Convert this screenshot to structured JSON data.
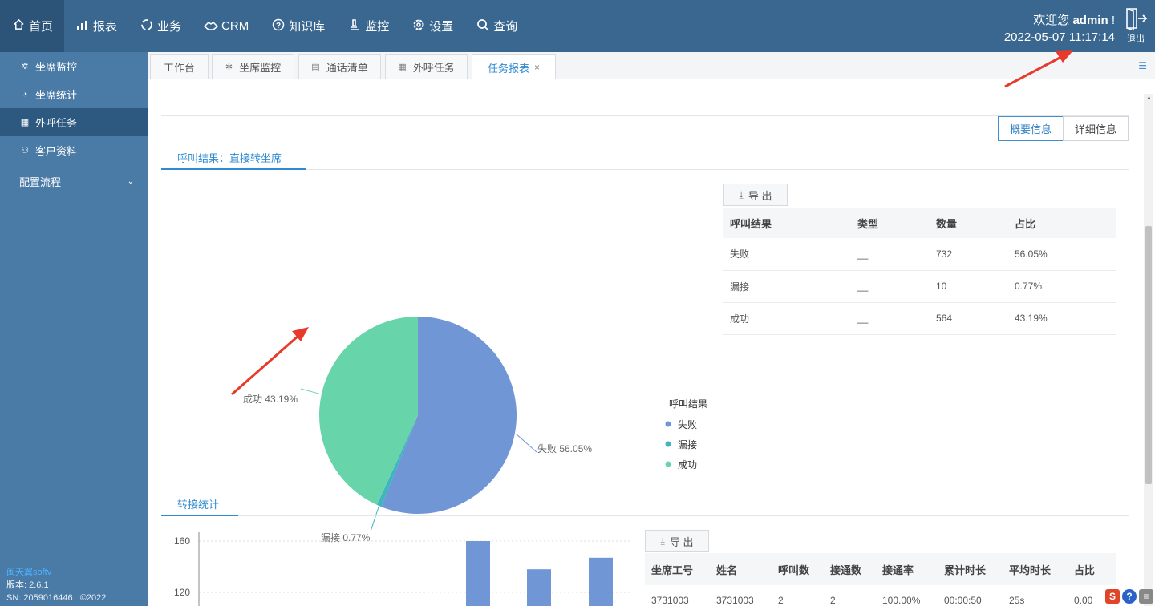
{
  "nav": {
    "items": [
      {
        "label": "首页",
        "icon": "home-icon"
      },
      {
        "label": "报表",
        "icon": "report-icon"
      },
      {
        "label": "业务",
        "icon": "business-icon"
      },
      {
        "label": "CRM",
        "icon": "crm-icon"
      },
      {
        "label": "知识库",
        "icon": "knowledge-icon"
      },
      {
        "label": "监控",
        "icon": "monitor-icon"
      },
      {
        "label": "设置",
        "icon": "gear-icon"
      },
      {
        "label": "查询",
        "icon": "search-icon"
      }
    ],
    "welcome_prefix": "欢迎您",
    "user": "admin",
    "welcome_suffix": "!",
    "datetime": "2022-05-07 11:17:14",
    "logout": "退出"
  },
  "sidebar": {
    "items": [
      {
        "label": "坐席监控",
        "icon": "agent-monitor-icon"
      },
      {
        "label": "坐席统计",
        "icon": "agent-stats-icon"
      },
      {
        "label": "外呼任务",
        "icon": "grid-icon"
      },
      {
        "label": "客户资料",
        "icon": "user-icon"
      }
    ],
    "group": "配置流程",
    "footer": {
      "brand": "闽天翼softv",
      "version": "版本: 2.6.1",
      "sn": "SN: 2059016446",
      "copyright": "©2022"
    }
  },
  "tabs": [
    {
      "label": "工作台"
    },
    {
      "label": "坐席监控"
    },
    {
      "label": "通话清单"
    },
    {
      "label": "外呼任务"
    },
    {
      "label": "任务报表"
    }
  ],
  "view_buttons": {
    "summary": "概要信息",
    "detail": "详细信息"
  },
  "section1": {
    "title": "呼叫结果：直接转坐席",
    "export": "导 出",
    "table": {
      "headers": [
        "呼叫结果",
        "类型",
        "数量",
        "占比"
      ],
      "rows": [
        [
          "失败",
          "__",
          "732",
          "56.05%"
        ],
        [
          "漏接",
          "__",
          "10",
          "0.77%"
        ],
        [
          "成功",
          "__",
          "564",
          "43.19%"
        ]
      ]
    }
  },
  "chart_data": [
    {
      "type": "pie",
      "slices": [
        {
          "name": "失败",
          "value": 732,
          "percent": 56.05,
          "label": "失败 56.05%",
          "color": "#7096d6"
        },
        {
          "name": "漏接",
          "value": 10,
          "percent": 0.77,
          "label": "漏接 0.77%",
          "color": "#3fb5c0"
        },
        {
          "name": "成功",
          "value": 564,
          "percent": 43.19,
          "label": "成功 43.19%",
          "color": "#67d4aa"
        }
      ],
      "legend": {
        "title": "呼叫结果",
        "placement": "bottom-right"
      }
    },
    {
      "type": "bar",
      "ylim": [
        100,
        160
      ],
      "yticks": [
        "160",
        "120"
      ],
      "values": [
        160,
        138,
        147
      ],
      "color": "#7096d6",
      "grid": true
    }
  ],
  "section2": {
    "title": "转接统计",
    "export": "导 出",
    "table": {
      "headers": [
        "坐席工号",
        "姓名",
        "呼叫数",
        "接通数",
        "接通率",
        "累计时长",
        "平均时长",
        "占比"
      ],
      "rows": [
        [
          "3731003",
          "3731003",
          "2",
          "2",
          "100.00%",
          "00:00:50",
          "25s",
          "0.00"
        ]
      ]
    }
  }
}
